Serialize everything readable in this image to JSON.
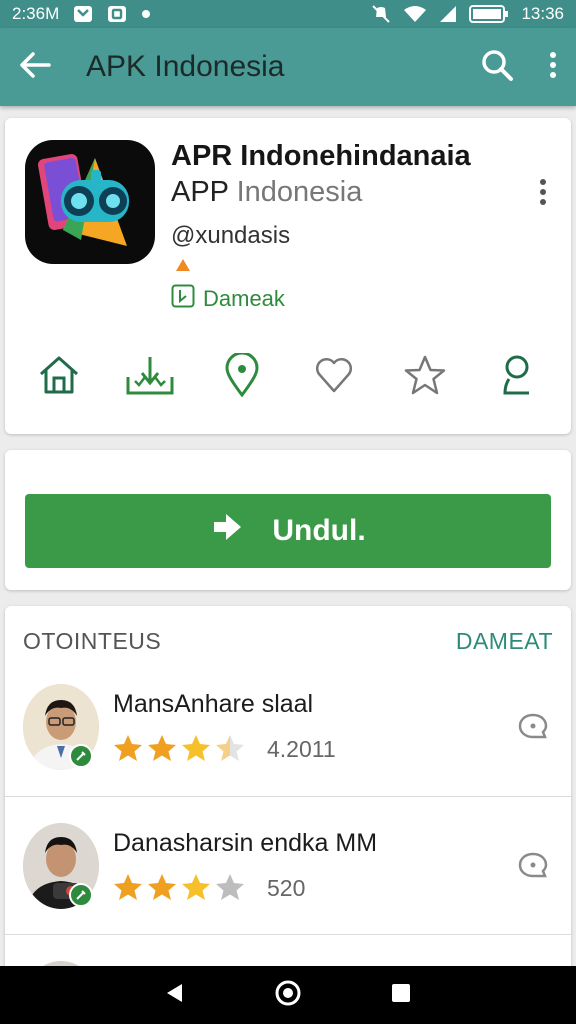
{
  "status_bar": {
    "time_left": "2:36M",
    "time_right": "13:36"
  },
  "app_bar": {
    "title": "APK Indonesia"
  },
  "app": {
    "name": "APR Indonehindanaia",
    "subtitle_dark": "APP",
    "subtitle_light": "Indonesia",
    "developer": "@xundasis",
    "badge_label": "Dameak",
    "icons": [
      "home-icon",
      "download-tray-icon",
      "location-pin-icon",
      "heart-icon",
      "star-outline-icon",
      "person-icon"
    ]
  },
  "download": {
    "label": "Undul."
  },
  "reviews": {
    "section_label": "OTOINTEUS",
    "action_label": "DAMEAT",
    "items": [
      {
        "name": "MansAnhare slaal",
        "rating": 3.5,
        "score": "4.2011"
      },
      {
        "name": "Danasharsin endka MM",
        "rating": 3,
        "score": "520"
      }
    ]
  },
  "colors": {
    "accent": "#4a9a95",
    "primary_green": "#3a9a48",
    "star": "#f0a020"
  }
}
